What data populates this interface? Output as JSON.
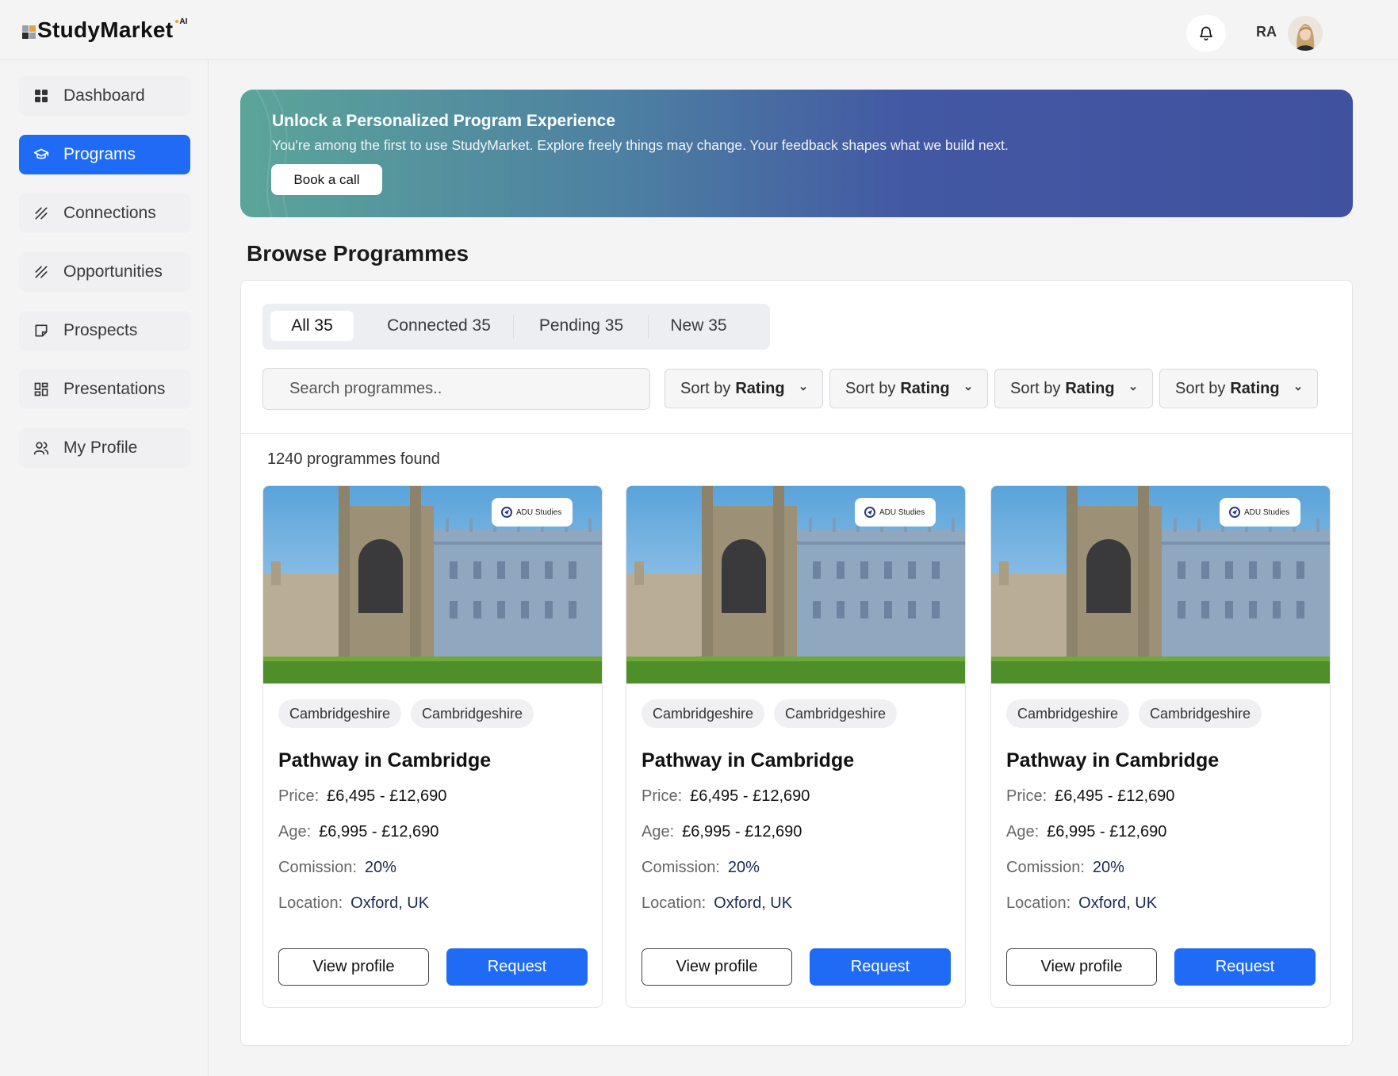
{
  "header": {
    "brand": "StudyMarket",
    "brand_suffix": "AI",
    "user_initials": "RA"
  },
  "sidebar": {
    "items": [
      {
        "label": "Dashboard",
        "icon": "dashboard-icon"
      },
      {
        "label": "Programs",
        "icon": "graduation-cap-icon",
        "active": true
      },
      {
        "label": "Connections",
        "icon": "connections-icon"
      },
      {
        "label": "Opportunities",
        "icon": "opportunities-icon"
      },
      {
        "label": "Prospects",
        "icon": "note-icon"
      },
      {
        "label": "Presentations",
        "icon": "layout-icon"
      },
      {
        "label": "My Profile",
        "icon": "users-icon"
      }
    ]
  },
  "banner": {
    "title": "Unlock a Personalized Program Experience",
    "text": "You're among the first to use StudyMarket. Explore freely things may change. Your feedback shapes what we build next.",
    "button": "Book a call"
  },
  "page": {
    "title": "Browse Programmes"
  },
  "tabs": [
    {
      "label": "All 35",
      "active": true
    },
    {
      "label": "Connected 35"
    },
    {
      "label": "Pending 35"
    },
    {
      "label": "New 35"
    }
  ],
  "search": {
    "placeholder": "Search programmes.."
  },
  "sort": [
    {
      "prefix": "Sort by",
      "value": "Rating"
    },
    {
      "prefix": "Sort by",
      "value": "Rating"
    },
    {
      "prefix": "Sort by",
      "value": "Rating"
    },
    {
      "prefix": "Sort by",
      "value": "Rating"
    }
  ],
  "results": {
    "count_text": "1240 programmes found"
  },
  "cards": [
    {
      "badge": "ADU Studies",
      "tags": [
        "Cambridgeshire",
        "Cambridgeshire"
      ],
      "title": "Pathway in Cambridge",
      "price_label": "Price:",
      "price": "£6,495 - £12,690",
      "age_label": "Age:",
      "age": "£6,995 - £12,690",
      "commission_label": "Comission:",
      "commission": "20%",
      "location_label": "Location:",
      "location": "Oxford, UK",
      "view_label": "View profile",
      "request_label": "Request"
    },
    {
      "badge": "ADU Studies",
      "tags": [
        "Cambridgeshire",
        "Cambridgeshire"
      ],
      "title": "Pathway in Cambridge",
      "price_label": "Price:",
      "price": "£6,495 - £12,690",
      "age_label": "Age:",
      "age": "£6,995 - £12,690",
      "commission_label": "Comission:",
      "commission": "20%",
      "location_label": "Location:",
      "location": "Oxford, UK",
      "view_label": "View profile",
      "request_label": "Request"
    },
    {
      "badge": "ADU Studies",
      "tags": [
        "Cambridgeshire",
        "Cambridgeshire"
      ],
      "title": "Pathway in Cambridge",
      "price_label": "Price:",
      "price": "£6,495 - £12,690",
      "age_label": "Age:",
      "age": "£6,995 - £12,690",
      "commission_label": "Comission:",
      "commission": "20%",
      "location_label": "Location:",
      "location": "Oxford, UK",
      "view_label": "View profile",
      "request_label": "Request"
    }
  ],
  "colors": {
    "primary": "#1f6bf5",
    "banner_start": "#5ba59a",
    "banner_end": "#3f519f"
  }
}
